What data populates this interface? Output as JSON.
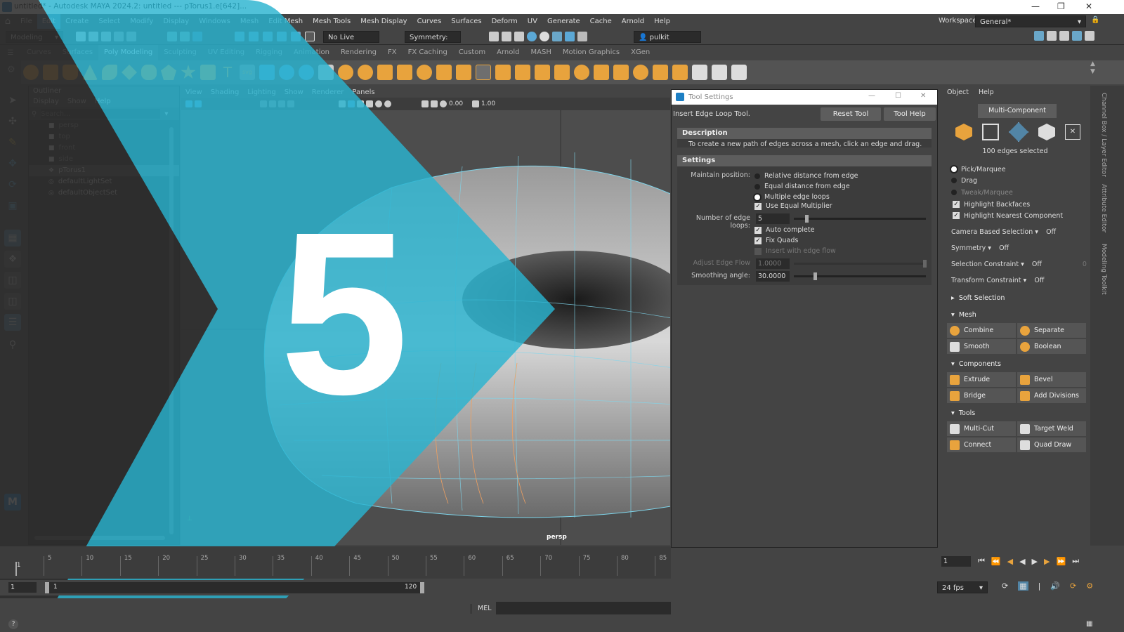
{
  "window": {
    "title": "untitled* - Autodesk MAYA 2024.2: untitled  ---  pTorus1.e[642]...",
    "workspace_label": "Workspace:",
    "workspace_value": "General*"
  },
  "menubar": {
    "items": [
      "File",
      "Edit",
      "Create",
      "Select",
      "Modify",
      "Display",
      "Windows",
      "Mesh",
      "Edit Mesh",
      "Mesh Tools",
      "Mesh Display",
      "Curves",
      "Surfaces",
      "Deform",
      "UV",
      "Generate",
      "Cache",
      "Arnold",
      "Help"
    ],
    "active": "Edit"
  },
  "statusline": {
    "mode": "Modeling",
    "live_surface": "No Live Surface",
    "symmetry": "Symmetry: Off",
    "user": "pulkit kachhwa."
  },
  "shelf_tabs": {
    "items": [
      "Curves",
      "Surfaces",
      "Poly Modeling",
      "Sculpting",
      "UV Editing",
      "Rigging",
      "Animation",
      "Rendering",
      "FX",
      "FX Caching",
      "Custom",
      "Arnold",
      "MASH",
      "Motion Graphics",
      "XGen"
    ],
    "active": "Poly Modeling"
  },
  "outliner": {
    "title": "Outliner",
    "menu": [
      "Display",
      "Show",
      "Help"
    ],
    "search_placeholder": "Search...",
    "items": [
      {
        "label": "persp",
        "dim": true
      },
      {
        "label": "top",
        "dim": true
      },
      {
        "label": "front",
        "dim": true
      },
      {
        "label": "side",
        "dim": true
      },
      {
        "label": "pTorus1",
        "dim": false
      },
      {
        "label": "defaultLightSet",
        "dim": false
      },
      {
        "label": "defaultObjectSet",
        "dim": false
      }
    ]
  },
  "viewport": {
    "menu": [
      "View",
      "Shading",
      "Lighting",
      "Show",
      "Renderer",
      "Panels"
    ],
    "field1": "0.00",
    "field2": "1.00",
    "camera_label": "persp"
  },
  "promo": {
    "number": "5",
    "color": "#29b3cf"
  },
  "tool_settings": {
    "window_title": "Tool Settings",
    "tool_name": "Insert Edge Loop Tool.",
    "reset_button": "Reset Tool",
    "help_button": "Tool Help",
    "description_header": "Description",
    "description_text": "To create a new path of edges across a mesh, click an edge and drag.",
    "settings_header": "Settings",
    "maintain_position_label": "Maintain position:",
    "maintain_options": [
      {
        "label": "Relative distance from edge",
        "selected": false
      },
      {
        "label": "Equal distance from edge",
        "selected": false
      },
      {
        "label": "Multiple edge loops",
        "selected": true
      }
    ],
    "use_equal_multiplier": "Use Equal Multiplier",
    "num_loops_label": "Number of edge loops:",
    "num_loops_value": "5",
    "auto_complete": "Auto complete",
    "fix_quads": "Fix Quads",
    "insert_edge_flow": "Insert with edge flow",
    "adjust_edge_flow_label": "Adjust Edge Flow",
    "adjust_edge_flow_value": "1.0000",
    "smoothing_angle_label": "Smoothing angle:",
    "smoothing_angle_value": "30.0000"
  },
  "modeling_toolkit": {
    "tabs": [
      "Object",
      "Help"
    ],
    "multi_component": "Multi-Component",
    "selection_info": "100 edges selected",
    "pick_marquee": "Pick/Marquee",
    "drag": "Drag",
    "tweak_marquee": "Tweak/Marquee",
    "highlight_backfaces": "Highlight Backfaces",
    "highlight_nearest": "Highlight Nearest Component",
    "camera_based_selection": "Camera Based Selection",
    "camera_based_value": "Off",
    "symmetry": "Symmetry",
    "symmetry_value": "Off",
    "selection_constraint": "Selection Constraint",
    "selection_constraint_value": "Off",
    "selection_constraint_num": "0",
    "transform_constraint": "Transform Constraint",
    "transform_constraint_value": "Off",
    "soft_selection": "Soft Selection",
    "mesh_header": "Mesh",
    "combine": "Combine",
    "separate": "Separate",
    "smooth": "Smooth",
    "boolean": "Boolean",
    "components_header": "Components",
    "extrude": "Extrude",
    "bevel": "Bevel",
    "bridge": "Bridge",
    "add_divisions": "Add Divisions",
    "tools_header": "Tools",
    "multi_cut": "Multi-Cut",
    "target_weld": "Target Weld",
    "connect": "Connect",
    "quad_draw": "Quad Draw"
  },
  "side_tabs": [
    "Channel Box / Layer Editor",
    "Attribute Editor",
    "Modeling Toolkit"
  ],
  "timeline": {
    "ticks": [
      "5",
      "10",
      "15",
      "20",
      "25",
      "30",
      "35",
      "40",
      "45",
      "50",
      "55",
      "60",
      "65",
      "70",
      "75",
      "80",
      "85"
    ],
    "current_frame_marker": "1"
  },
  "range": {
    "start": "1",
    "inner_start": "1",
    "inner_end": "120"
  },
  "command_line": {
    "language": "MEL"
  },
  "playback": {
    "current_frame": "1",
    "fps": "24 fps"
  }
}
